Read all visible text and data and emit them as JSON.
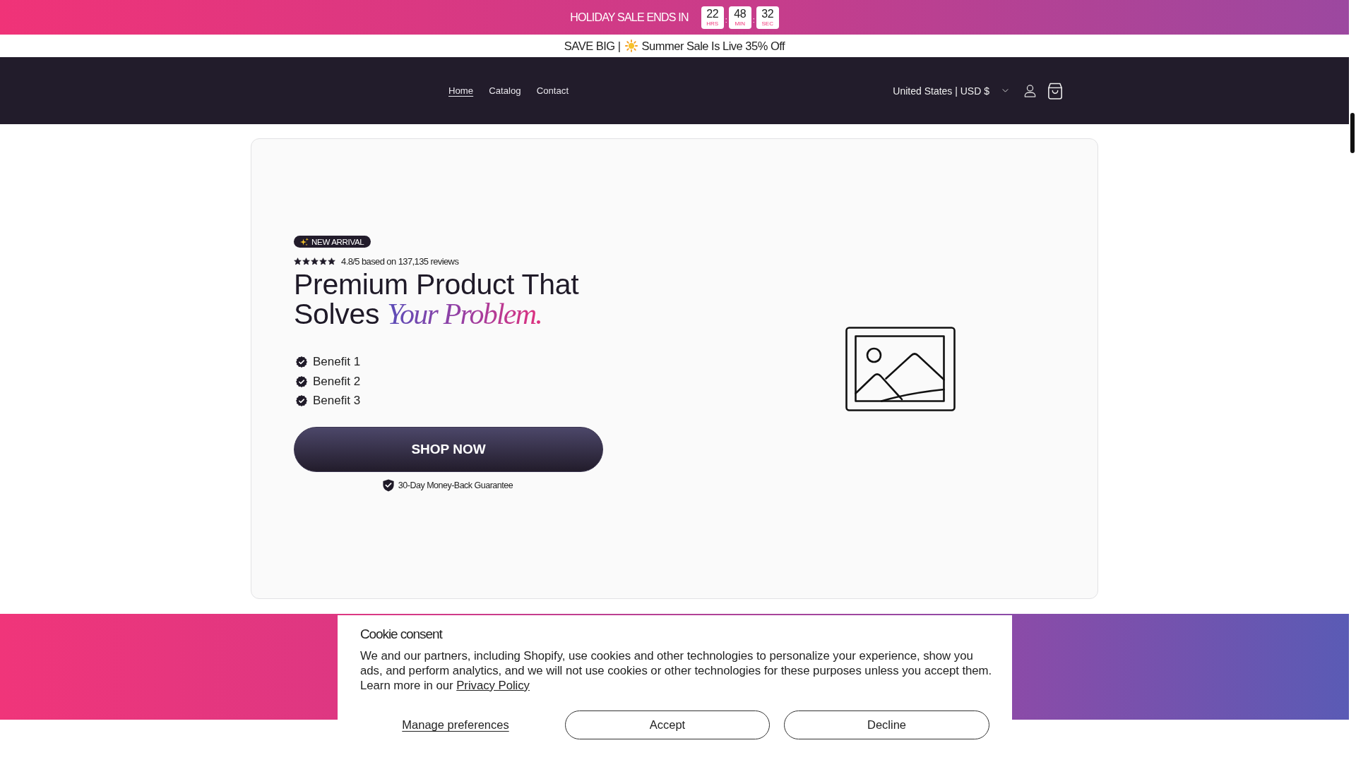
{
  "countdown": {
    "label": "HOLIDAY SALE ENDS IN",
    "units": [
      {
        "value": "22",
        "unit": "HRS"
      },
      {
        "value": "48",
        "unit": "MIN"
      },
      {
        "value": "32",
        "unit": "SEC"
      }
    ],
    "separators": [
      ":",
      ":"
    ]
  },
  "announcement": {
    "lead": "SAVE BIG |",
    "text": "Summer Sale Is Live 35% Off"
  },
  "header": {
    "nav": [
      {
        "label": "Home",
        "selected": true
      },
      {
        "label": "Catalog",
        "selected": false
      },
      {
        "label": "Contact",
        "selected": false
      }
    ],
    "locale": "United States | USD $"
  },
  "hero": {
    "badge": "NEW ARRIVAL",
    "rating": {
      "stars": 5,
      "text": "4.8/5 based on 137,135 reviews"
    },
    "heading": "Premium Product That Solves *Your Problem.*",
    "benefits": [
      "Benefit 1",
      "Benefit 2",
      "Benefit 3"
    ],
    "button": "SHOP NOW",
    "guarantee": "30-Day Money-Back Guarantee"
  },
  "cookie": {
    "title": "Cookie consent",
    "body": "We and our partners, including Shopify, use cookies and other technologies to personalize your experience, show you ads, and perform analytics, and we will not use cookies or other technologies for these purposes unless you accept them. Learn more in our",
    "link": "Privacy Policy",
    "buttons": [
      {
        "label": "Manage preferences",
        "kind": "link"
      },
      {
        "label": "Accept",
        "kind": "outline"
      },
      {
        "label": "Decline",
        "kind": "outline"
      }
    ]
  }
}
